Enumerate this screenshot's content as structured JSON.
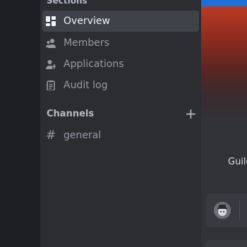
{
  "sidebar": {
    "section_title": "Sections",
    "items": [
      {
        "label": "Overview",
        "icon": "overview-icon",
        "active": true
      },
      {
        "label": "Members",
        "icon": "members-icon",
        "active": false
      },
      {
        "label": "Applications",
        "icon": "applications-icon",
        "active": false
      },
      {
        "label": "Audit log",
        "icon": "audit-log-icon",
        "active": false
      }
    ],
    "channels_title": "Channels",
    "add_icon": "plus-icon",
    "channels": [
      {
        "label": "general",
        "icon": "hash-icon"
      }
    ]
  },
  "main": {
    "guild_text": "Guild",
    "banner_color": "#b83b24",
    "accent_color": "#1e6fd9"
  },
  "colors": {
    "sidebar_bg": "#2b2d31",
    "active_bg": "#404249",
    "text_active": "#f2f3f5",
    "text_muted": "#949ba4"
  }
}
